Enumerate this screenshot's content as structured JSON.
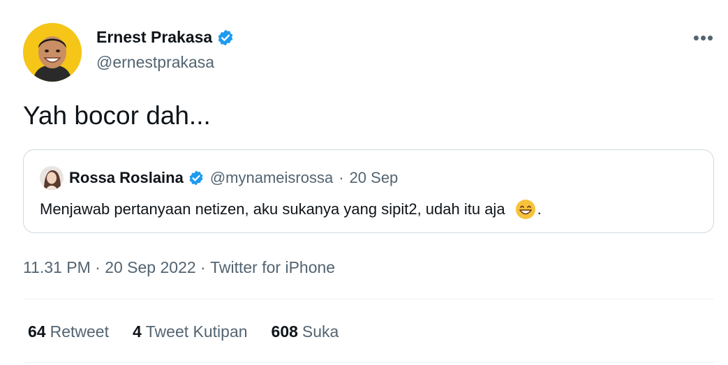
{
  "author": {
    "name": "Ernest Prakasa",
    "handle": "@ernestprakasa",
    "verified": true
  },
  "tweet": {
    "text": "Yah bocor dah..."
  },
  "quoted_tweet": {
    "name": "Rossa Roslaina",
    "handle": "@mynameisrossa",
    "separator": "·",
    "date": "20 Sep",
    "text": "Menjawab pertanyaan netizen, aku sukanya yang sipit2, udah itu aja",
    "emoji": "grinning-face-smiling-eyes",
    "trailing": "."
  },
  "meta": {
    "time": "11.31 PM",
    "separator": " · ",
    "date": "20 Sep 2022",
    "source": "Twitter for iPhone"
  },
  "stats": [
    {
      "count": "64",
      "label": "Retweet"
    },
    {
      "count": "4",
      "label": "Tweet Kutipan"
    },
    {
      "count": "608",
      "label": "Suka"
    }
  ],
  "colors": {
    "verified": "#1d9bf0",
    "secondary_text": "#536471",
    "primary_text": "#0f1419",
    "border": "#cfd9de"
  },
  "icons": {
    "more": "more-options-icon",
    "verified": "verified-badge-icon"
  }
}
